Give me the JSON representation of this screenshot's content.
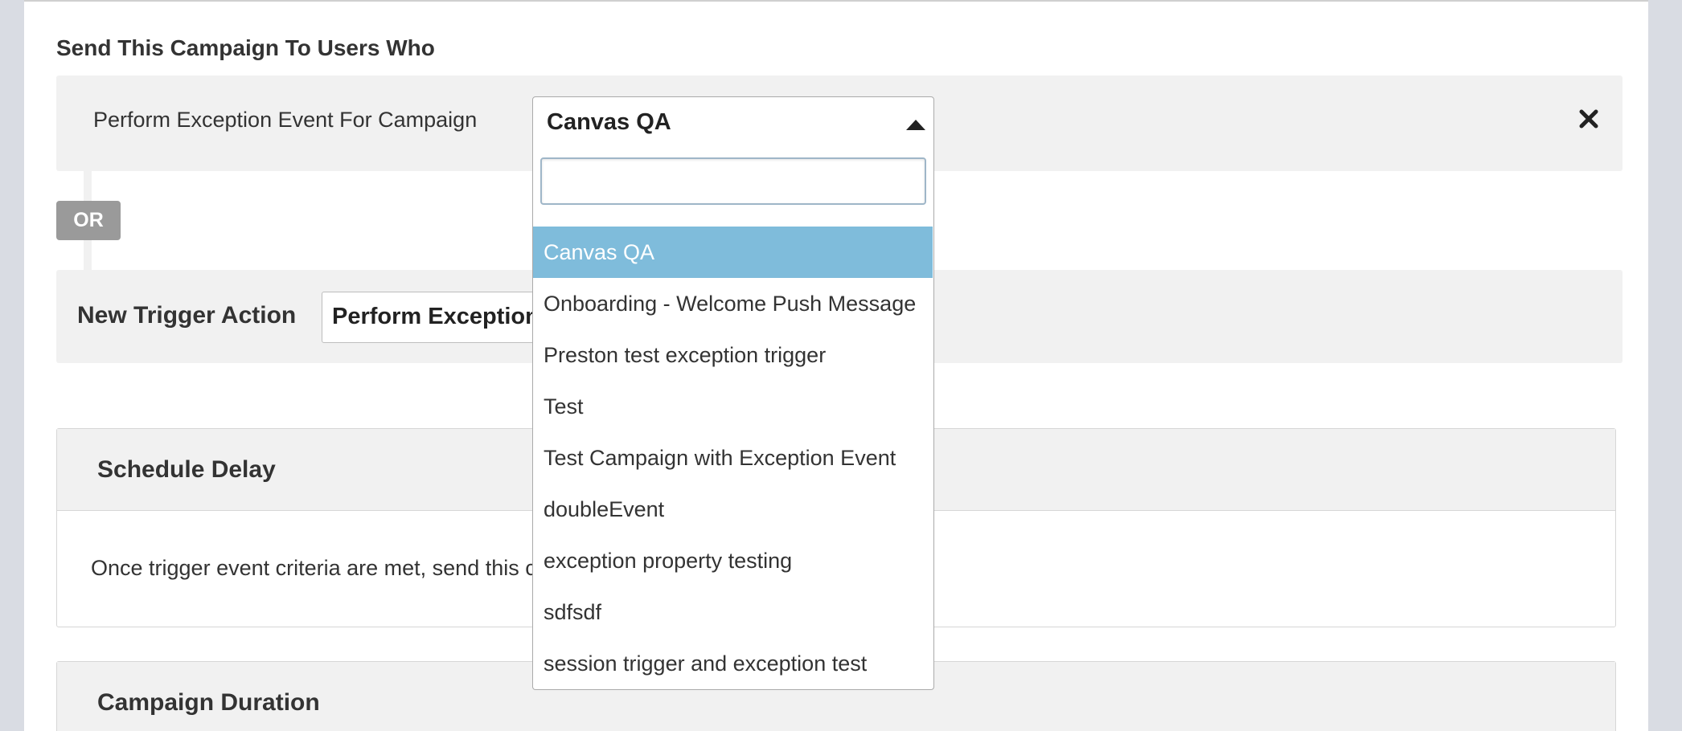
{
  "form": {
    "heading": "Send This Campaign To Users Who",
    "trigger_label": "Perform Exception Event For Campaign",
    "or_label": "OR",
    "new_trigger_label": "New Trigger Action",
    "new_trigger_value": "Perform Exception"
  },
  "campaign_select": {
    "selected": "Canvas QA",
    "search_value": "",
    "options": [
      "Canvas QA",
      "Onboarding - Welcome Push Message",
      "Preston test exception trigger",
      "Test",
      "Test Campaign with Exception Event",
      "doubleEvent",
      "exception property testing",
      "sdfsdf",
      "session trigger and exception test"
    ],
    "highlighted_index": 0
  },
  "schedule_delay": {
    "title": "Schedule Delay",
    "body": "Once trigger event criteria are met, send this c"
  },
  "campaign_duration": {
    "title": "Campaign Duration"
  },
  "colors": {
    "highlight": "#7fbcdb",
    "row_background": "#f1f1f1",
    "or_badge": "#9a9a9a"
  }
}
